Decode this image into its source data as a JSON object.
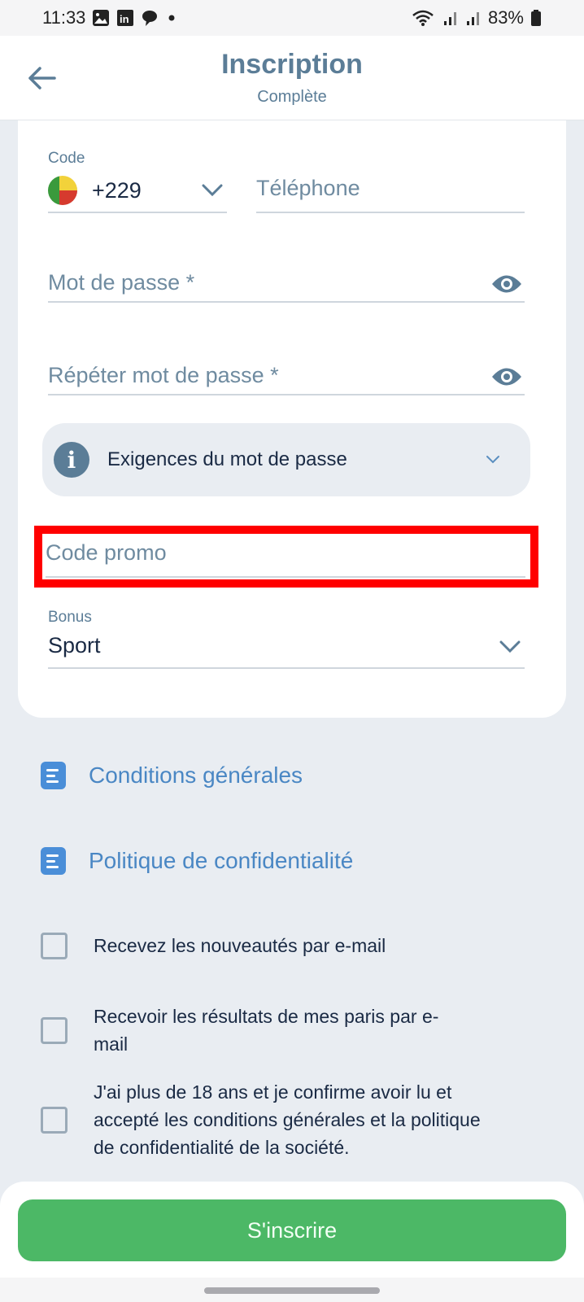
{
  "status_bar": {
    "time": "11:33",
    "left_icons": [
      "gallery-icon",
      "linkedin-icon",
      "chat-bubble-icon",
      "dot-icon"
    ],
    "right_icons": [
      "wifi-icon",
      "signal-icon",
      "signal-icon"
    ],
    "battery": "83%"
  },
  "header": {
    "title": "Inscription",
    "subtitle": "Complète",
    "back_icon": "arrow-left-icon"
  },
  "form": {
    "code": {
      "label": "Code",
      "value": "+229",
      "flag": "benin-flag"
    },
    "phone": {
      "placeholder": "Téléphone"
    },
    "password": {
      "placeholder": "Mot de passe *"
    },
    "repeat_password": {
      "placeholder": "Répéter mot de passe *"
    },
    "password_requirements": {
      "label": "Exigences du mot de passe"
    },
    "promo_code": {
      "placeholder": "Code promo"
    },
    "bonus": {
      "label": "Bonus",
      "value": "Sport"
    }
  },
  "links": [
    {
      "label": "Conditions générales"
    },
    {
      "label": "Politique de confidentialité"
    }
  ],
  "checkboxes": [
    {
      "label": "Recevez les nouveautés par e-mail",
      "checked": false
    },
    {
      "label": "Recevoir les résultats de mes paris par e-mail",
      "checked": false
    },
    {
      "label": "J'ai plus de 18 ans et je confirme avoir lu et accepté les conditions générales et la politique de confidentialité de la société.",
      "checked": false
    }
  ],
  "submit": {
    "label": "S'inscrire"
  },
  "colors": {
    "accent": "#5b7d97",
    "link": "#4a87c4",
    "primary_button": "#4cb866",
    "highlight": "#ff0000"
  }
}
